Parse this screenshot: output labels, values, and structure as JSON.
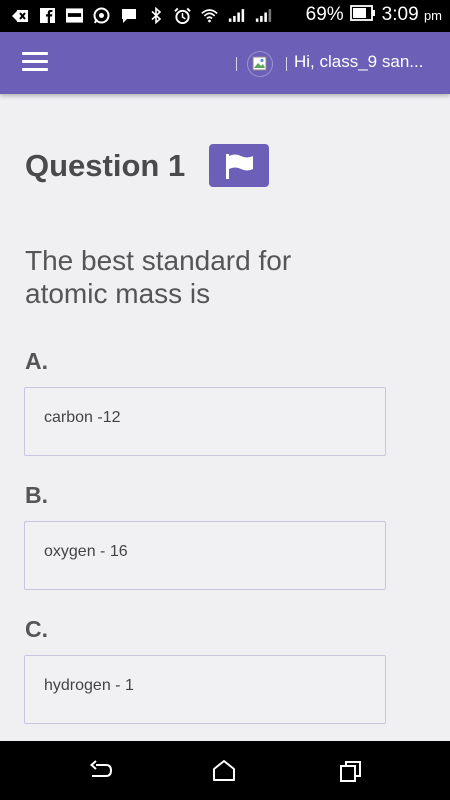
{
  "status_bar": {
    "battery": "69%",
    "time": "3:09",
    "ampm": "pm",
    "icons": [
      "back-arrow-icon",
      "facebook-icon",
      "news-icon",
      "whatsapp-icon",
      "message-icon",
      "bluetooth-icon",
      "alarm-icon",
      "wifi-icon",
      "signal-icon",
      "signal-icon",
      "battery-icon"
    ]
  },
  "app_bar": {
    "menu_icon": "hamburger-icon",
    "greeting": "Hi, class_9 san..."
  },
  "question": {
    "title": "Question 1",
    "flag_icon": "flag-icon",
    "text": "The best standard for atomic mass is",
    "options": [
      {
        "label": "A.",
        "text": "carbon -12"
      },
      {
        "label": "B.",
        "text": "oxygen - 16"
      },
      {
        "label": "C.",
        "text": "hydrogen - 1"
      }
    ]
  },
  "nav_bar": {
    "icons": [
      "back-icon",
      "home-icon",
      "recents-icon"
    ]
  }
}
